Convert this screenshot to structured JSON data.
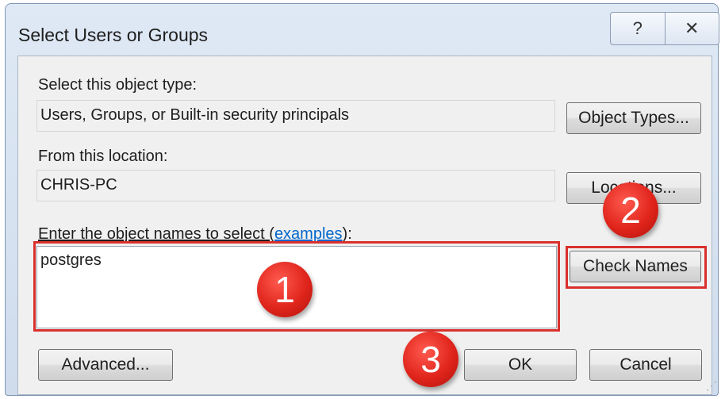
{
  "dialog": {
    "title": "Select Users or Groups",
    "help_icon": "question-mark-icon",
    "close_icon": "close-icon",
    "help_glyph": "?",
    "close_glyph": "✕"
  },
  "object_type": {
    "label": "Select this object type:",
    "value": "Users, Groups, or Built-in security principals",
    "button_label": "Object Types..."
  },
  "location": {
    "label": "From this location:",
    "value": "CHRIS-PC",
    "button_label": "Locations..."
  },
  "names": {
    "label_prefix": "Enter the object names to select (",
    "label_link": "examples",
    "label_suffix": "):",
    "value": "postgres",
    "check_names_label": "Check Names"
  },
  "footer": {
    "advanced_label": "Advanced...",
    "ok_label": "OK",
    "cancel_label": "Cancel"
  },
  "annotations": {
    "step1": "1",
    "step2": "2",
    "step3": "3",
    "color": "#e0251c"
  }
}
